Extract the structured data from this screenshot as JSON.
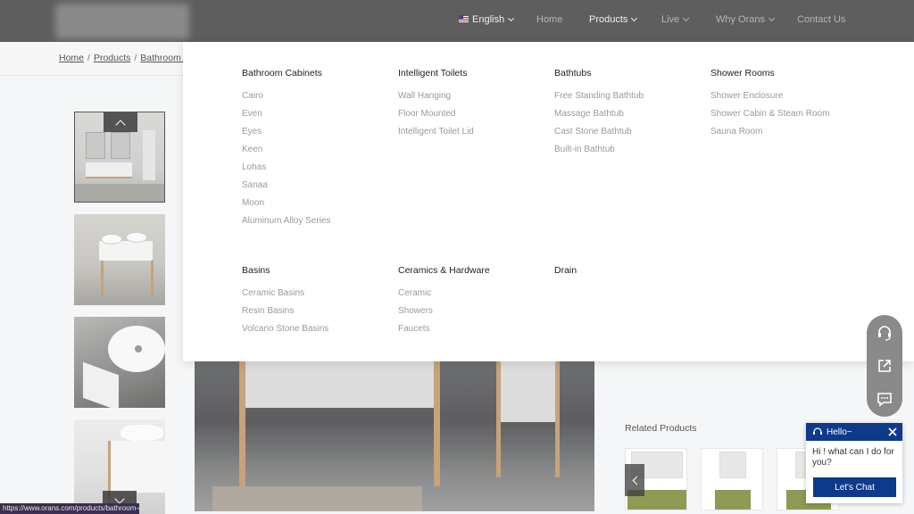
{
  "header": {
    "language": "English",
    "nav": [
      {
        "label": "Home"
      },
      {
        "label": "Products"
      },
      {
        "label": "Live"
      },
      {
        "label": "Why Orans"
      },
      {
        "label": "Contact Us"
      }
    ]
  },
  "breadcrumb": {
    "items": [
      "Home",
      "Products",
      "Bathroom C"
    ]
  },
  "mega_menu": {
    "columns": [
      {
        "title": "Bathroom Cabinets",
        "items": [
          "Cairo",
          "Even",
          "Eyes",
          "Keen",
          "Lohas",
          "Sanaa",
          "Moon",
          "Aluminum Alloy Series"
        ]
      },
      {
        "title": "Intelligent Toilets",
        "items": [
          "Wall Hanging",
          "Floor Mounted",
          "Intelligent Toilet Lid"
        ]
      },
      {
        "title": "Bathtubs",
        "items": [
          "Free Standing Bathtub",
          "Massage Bathtub",
          "Cast Stone Bathtub",
          "Built-in Bathtub"
        ]
      },
      {
        "title": "Shower Rooms",
        "items": [
          "Shower Enclosure",
          "Shower Cabin & Steam Room",
          "Sauna Room"
        ]
      },
      {
        "title": "Basins",
        "items": [
          "Ceramic Basins",
          "Resin Basins",
          "Volcano Stone Basins"
        ]
      },
      {
        "title": "Ceramics & Hardware",
        "items": [
          "Ceramic",
          "Showers",
          "Faucets"
        ]
      },
      {
        "title": "Drain",
        "items": []
      }
    ]
  },
  "related": {
    "title": "Related Products"
  },
  "chat": {
    "header": "Hello~",
    "message": "Hi ! what can I do for you?",
    "button": "Let's Chat"
  },
  "status_bar": {
    "url": "https://www.orans.com/products/bathroom-cabinets/"
  },
  "colors": {
    "header_bg": "#5e5e5e",
    "chat_blue": "#0d3b8a",
    "menu_item": "#9a9a9a"
  }
}
